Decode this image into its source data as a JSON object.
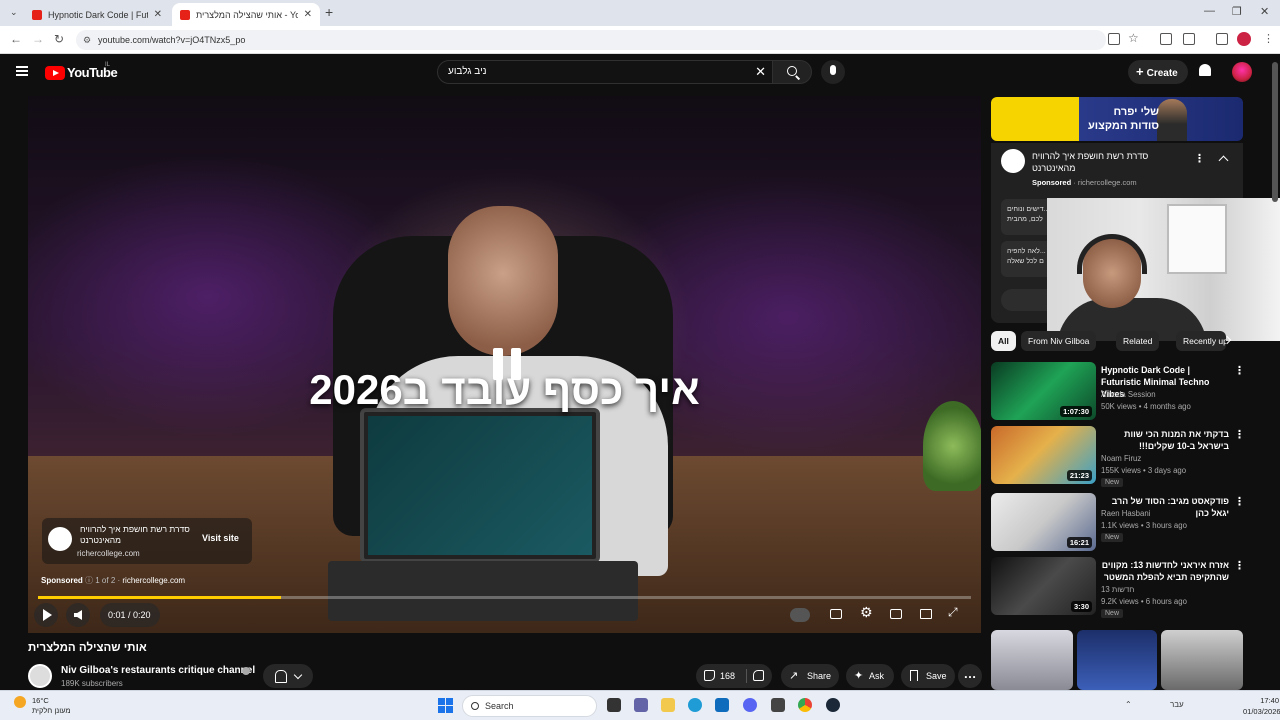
{
  "browser": {
    "tabs": [
      {
        "title": "Hypnotic Dark Code | Futuristic",
        "active": false
      },
      {
        "title": "אותי שהצילה המלצרית - YouTube",
        "active": true
      }
    ],
    "url": "youtube.com/watch?v=jO4TNzx5_po"
  },
  "header": {
    "logo_text": "YouTube",
    "country_code": "IL",
    "search_value": "ניב גלבוע",
    "create_label": "Create"
  },
  "player": {
    "overlay_title": "איך כסף עובד ב2026",
    "ad_title": "סדרת רשת חושפת איך להרוויח מהאינטרנט",
    "ad_domain": "richercollege.com",
    "visit_label": "Visit site",
    "ad_meta_sponsored": "Sponsored",
    "ad_meta_index": "1 of 2",
    "ad_meta_domain": "richercollege.com",
    "time": "0:01 / 0:20",
    "progress": 0.26
  },
  "video": {
    "title": "אותי שהצילה המלצרית",
    "channel": "Niv Gilboa's restaurants critique channel",
    "subscribers": "189K subscribers",
    "likes": "168",
    "share_label": "Share",
    "ask_label": "Ask",
    "save_label": "Save"
  },
  "sidebar": {
    "banner_text": "שלי יפרח\nסודות המקצוע",
    "sponsor_title": "סדרת רשת חושפת איך להרוויח מהאינטרנט",
    "sponsor_label": "Sponsored",
    "sponsor_domain": "richercollege.com",
    "sponsor_box1": "...דישים ונוחים\nלכם, מהבית",
    "sponsor_box2": "...לאה להפיה\nם לכל שאלה",
    "chips": [
      "All",
      "From Niv Gilboa",
      "Related",
      "Recently uploaded"
    ],
    "recommendations": [
      {
        "title": "Hypnotic Dark Code | Futuristic Minimal Techno Vibes",
        "channel": "Amoda Session",
        "stats": "50K views • 4 months ago",
        "duration": "1:07:30",
        "badge": "",
        "rtl": false
      },
      {
        "title": "בדקתי את המנות הכי שוות בישראל ב-10 שקלים!!!",
        "channel": "Noam Firuz",
        "stats": "155K views • 3 days ago",
        "duration": "21:23",
        "badge": "New",
        "rtl": true
      },
      {
        "title": "פודקאסט מגיב: הסוד של הרב יגאל כהן",
        "channel": "Raen Hasbani",
        "stats": "1.1K views • 3 hours ago",
        "duration": "16:21",
        "badge": "New",
        "rtl": true
      },
      {
        "title": "אזרח איראני לחדשות 13: מקווים שהתקיפה תביא להפלת המשטר",
        "channel": "חדשות 13",
        "stats": "9.2K views • 6 hours ago",
        "duration": "3:30",
        "badge": "New",
        "rtl": true
      }
    ]
  },
  "taskbar": {
    "weather_temp": "16°C",
    "weather_desc": "מעונן חלקית",
    "search_label": "Search",
    "lang": "עבר",
    "time": "17:40",
    "date": "01/03/2026"
  },
  "colors": {
    "brand_red": "#ff0000",
    "progress": "#ffcc00",
    "bg": "#0f0f0f"
  }
}
